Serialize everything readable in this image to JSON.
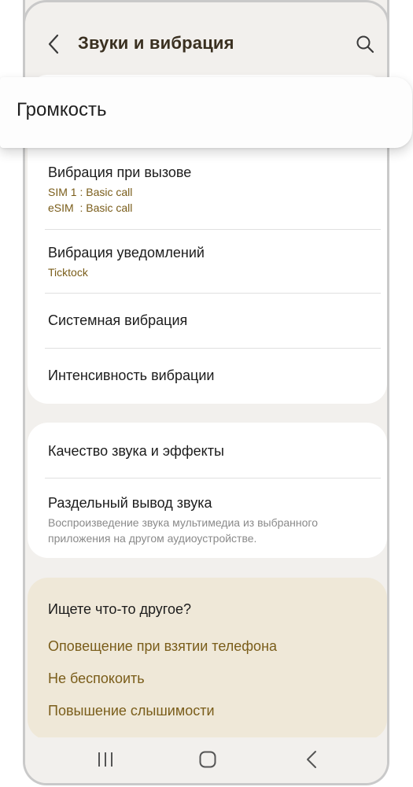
{
  "header": {
    "title": "Звуки и вибрация"
  },
  "volume_card": {
    "label": "Громкость"
  },
  "vibration_section": {
    "call_vibration": {
      "title": "Вибрация при вызове",
      "sub1": "SIM 1 : Basic call",
      "sub2": "eSIM  : Basic call"
    },
    "notification_vibration": {
      "title": "Вибрация уведомлений",
      "sub": "Ticktock"
    },
    "system_vibration": {
      "title": "Системная вибрация"
    },
    "vibration_intensity": {
      "title": "Интенсивность вибрации"
    }
  },
  "sound_section": {
    "quality": {
      "title": "Качество звука и эффекты"
    },
    "separate_output": {
      "title": "Раздельный вывод звука",
      "desc": "Воспроизведение звука мультимедиа из выбранного приложения на другом аудиоустройстве."
    }
  },
  "looking_for": {
    "title": "Ищете что-то другое?",
    "links": [
      "Оповещение при взятии телефона",
      "Не беспокоить",
      "Повышение слышимости"
    ]
  },
  "icons": {
    "back": "back-arrow-icon",
    "search": "search-icon",
    "recents": "recents-icon",
    "home": "home-icon",
    "nav_back": "nav-back-icon"
  },
  "colors": {
    "accent": "#7a5d1a",
    "background": "#f2f0ed",
    "suggestion_card": "#efe8d8"
  }
}
